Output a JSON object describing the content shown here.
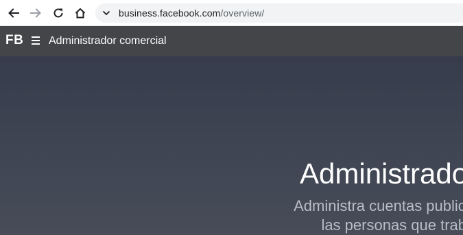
{
  "browser": {
    "url_host": "business.facebook.com",
    "url_path": "/overview/"
  },
  "header": {
    "logo": "FB",
    "title": "Administrador comercial"
  },
  "hero": {
    "title": "Administrador",
    "subtitle": "Administra cuentas publicitarias, páginas y las personas que trabajan en ellas"
  },
  "colors": {
    "header_bg": "#444548",
    "hero_bg_top": "#363c4b",
    "hero_bg_bottom": "#474c58",
    "hero_text": "#ffffff",
    "hero_subtext": "#b9bdc6"
  },
  "icons": {
    "back": "arrow-left-icon",
    "forward": "arrow-right-icon",
    "reload": "reload-icon",
    "home": "home-icon",
    "omnibox_dropdown": "chevron-down-icon",
    "menu": "hamburger-menu-icon"
  }
}
